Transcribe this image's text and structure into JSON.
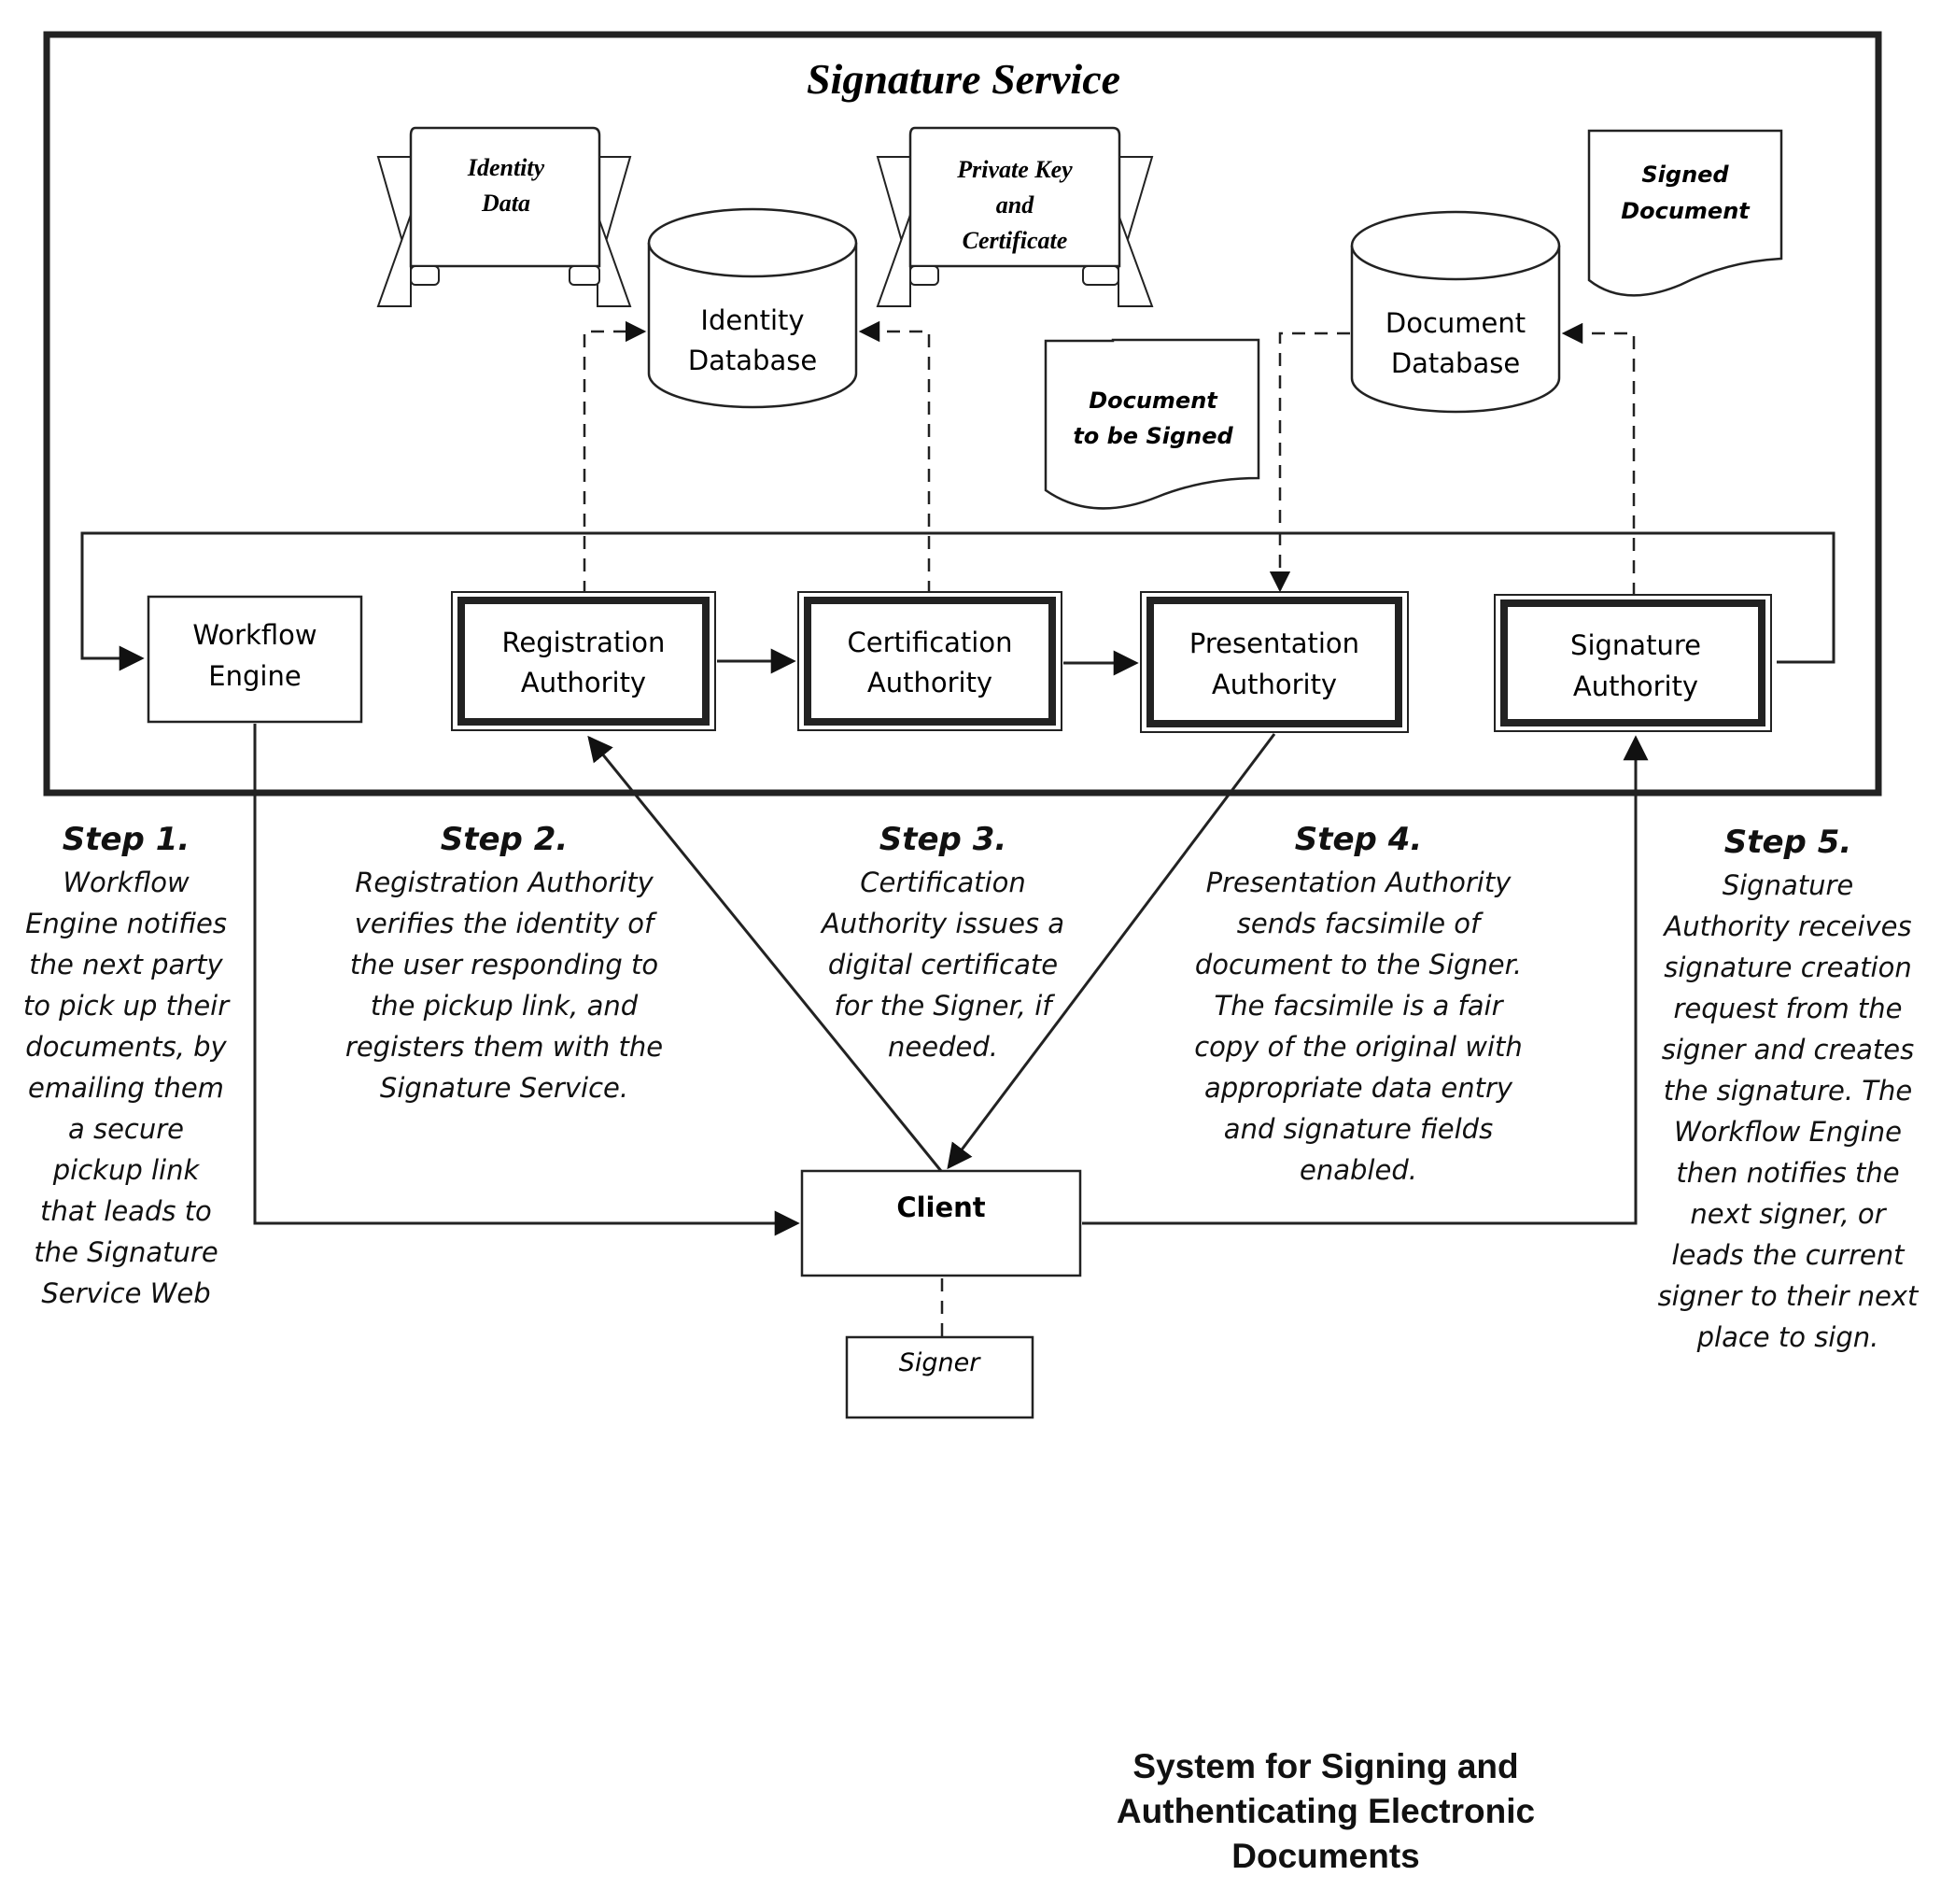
{
  "service": {
    "title": "Signature Service"
  },
  "scrolls": {
    "identity_data": [
      "Identity",
      "Data"
    ],
    "private_key": [
      "Private Key",
      "and",
      "Certificate"
    ]
  },
  "databases": {
    "identity": [
      "Identity",
      "Database"
    ],
    "document": [
      "Document",
      "Database"
    ]
  },
  "documents": {
    "to_be_signed": [
      "Document",
      "to be Signed"
    ],
    "signed": [
      "Signed",
      "Document"
    ]
  },
  "components": {
    "workflow_engine": [
      "Workflow",
      "Engine"
    ],
    "registration_authority": [
      "Registration",
      "Authority"
    ],
    "certification_authority": [
      "Certification",
      "Authority"
    ],
    "presentation_authority": [
      "Presentation",
      "Authority"
    ],
    "signature_authority": [
      "Signature",
      "Authority"
    ],
    "client": "Client",
    "signer": "Signer"
  },
  "steps": [
    {
      "title": "Step 1.",
      "lines": [
        "Workflow",
        "Engine notifies",
        "the next party",
        "to pick up their",
        "documents, by",
        "emailing them",
        "a secure",
        "pickup link",
        "that leads to",
        "the Signature",
        "Service Web"
      ]
    },
    {
      "title": "Step 2.",
      "lines": [
        "Registration Authority",
        "verifies the identity of",
        "the user responding to",
        "the pickup link, and",
        "registers them with the",
        "Signature Service."
      ]
    },
    {
      "title": "Step 3.",
      "lines": [
        "Certification",
        "Authority issues a",
        "digital certificate",
        "for the Signer, if",
        "needed."
      ]
    },
    {
      "title": "Step 4.",
      "lines": [
        "Presentation Authority",
        "sends facsimile of",
        "document to the Signer.",
        "The facsimile is a fair",
        "copy of the original with",
        "appropriate data entry",
        "and signature fields",
        "enabled."
      ]
    },
    {
      "title": "Step 5.",
      "lines": [
        "Signature",
        "Authority receives",
        "signature creation",
        "request from the",
        "signer and creates",
        "the signature. The",
        "Workflow Engine",
        "then notifies the",
        "next signer, or",
        "leads the current",
        "signer to their next",
        "place to sign."
      ]
    }
  ],
  "caption": [
    "System for Signing and",
    "Authenticating Electronic",
    "Documents"
  ]
}
